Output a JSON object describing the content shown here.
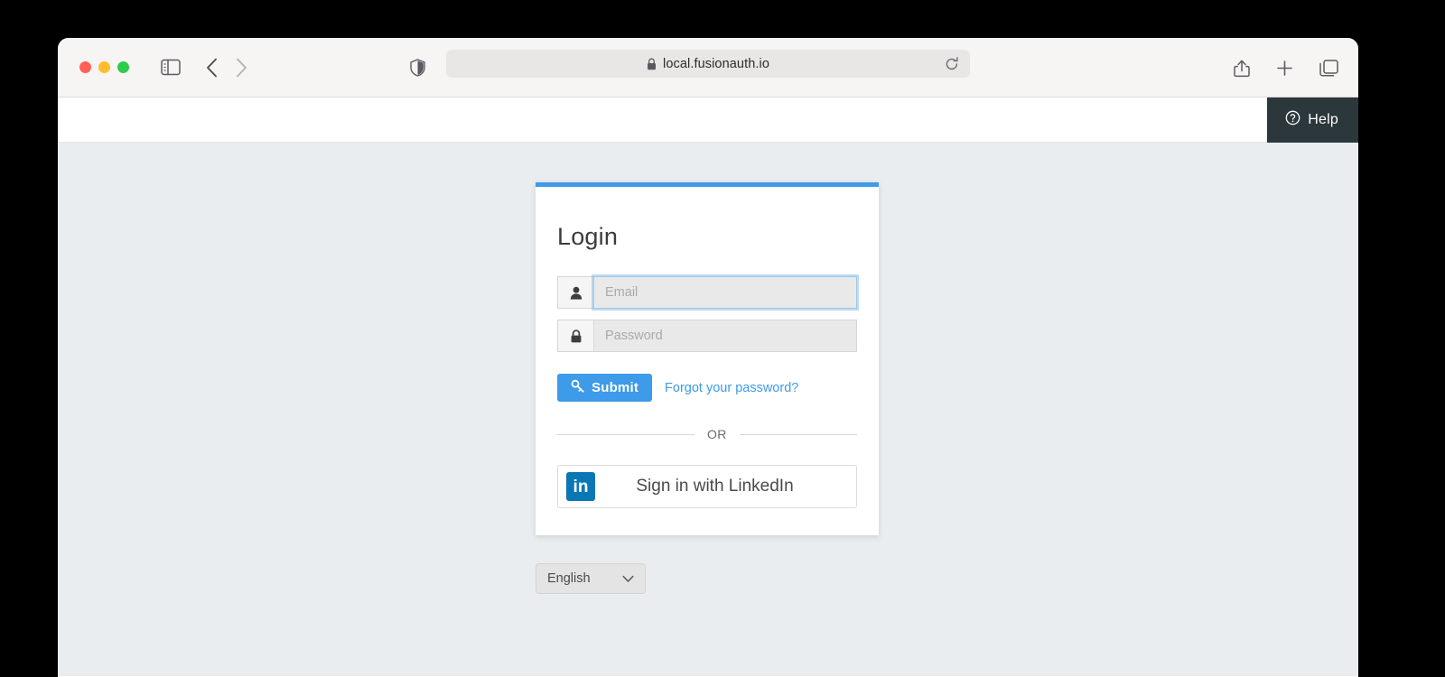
{
  "browser": {
    "url": "local.fusionauth.io",
    "icons": {
      "sidebar": "sidebar-icon",
      "back": "back-chevron-icon",
      "forward": "forward-chevron-icon",
      "shield": "privacy-shield-icon",
      "lock": "lock-icon",
      "reload": "reload-icon",
      "share": "share-icon",
      "new_tab": "plus-icon",
      "tab_overview": "tab-overview-icon"
    }
  },
  "app_header": {
    "help_label": "Help",
    "help_icon": "question-circle-icon",
    "help_bg": "#2b373b"
  },
  "login": {
    "title": "Login",
    "accent_color": "#3d9be9",
    "email": {
      "placeholder": "Email",
      "value": "",
      "icon": "user-icon",
      "focused": true
    },
    "password": {
      "placeholder": "Password",
      "value": "",
      "icon": "lock-icon",
      "focused": false
    },
    "submit_label": "Submit",
    "submit_icon": "key-icon",
    "forgot_label": "Forgot your password?",
    "divider_label": "OR",
    "linkedin": {
      "label": "Sign in with LinkedIn",
      "logo_text": "in",
      "logo_color": "#0a77b5"
    }
  },
  "language": {
    "selected": "English",
    "chevron_icon": "chevron-down-icon"
  }
}
